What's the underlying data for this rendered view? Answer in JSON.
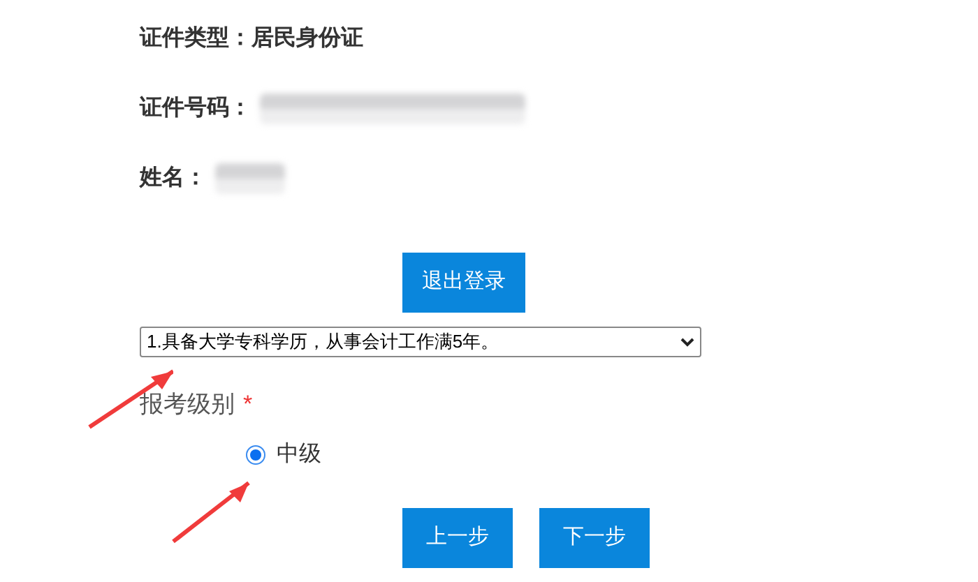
{
  "identity": [
    {
      "label": "证件类型：",
      "kind": "text",
      "value": "居民身份证"
    },
    {
      "label": "证件号码：",
      "kind": "redacted"
    },
    {
      "label": "姓名：",
      "kind": "redacted"
    }
  ],
  "logout_button": "退出登录",
  "qualification_select": {
    "value": "1.具备大学专科学历，从事会计工作满5年。"
  },
  "level_field": {
    "label": "报考级别",
    "required_mark": "*",
    "options": [
      {
        "label": "中级",
        "selected": true
      }
    ]
  },
  "buttons": [
    "上一步",
    "下一步"
  ],
  "annotations": [
    {
      "kind": "arrow"
    },
    {
      "kind": "arrow"
    }
  ]
}
